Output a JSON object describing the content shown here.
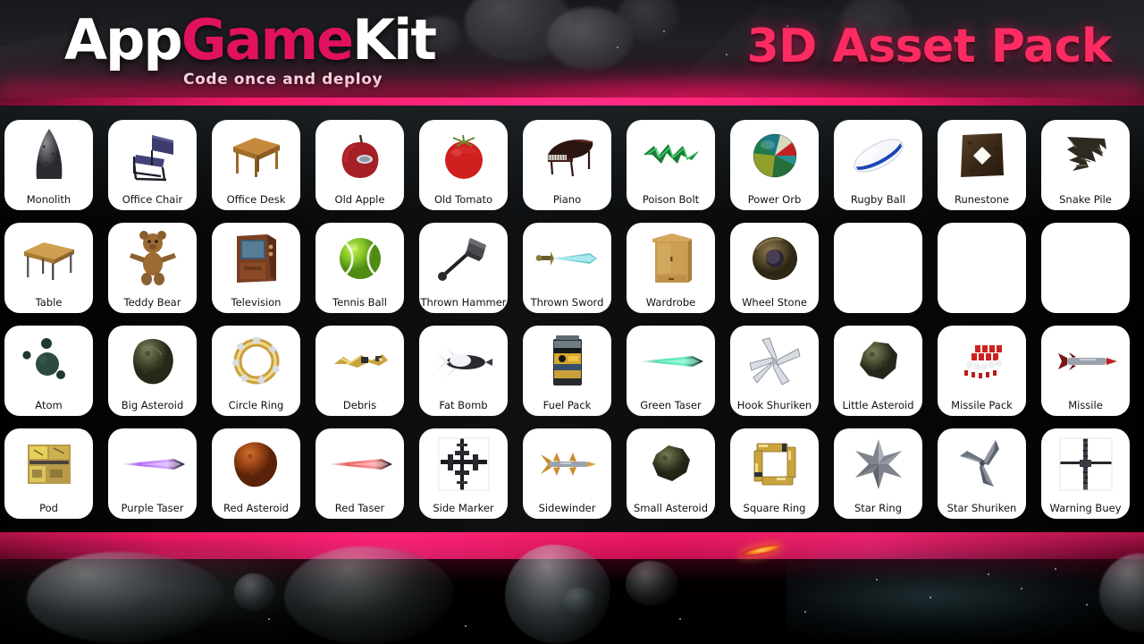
{
  "header": {
    "logo_part1": "App",
    "logo_part2": "Game",
    "logo_part3": "Kit",
    "tagline": "Code once and deploy",
    "pack_title": "3D Asset Pack",
    "colors": {
      "logo_white": "#ffffff",
      "logo_pink": "#e0115f",
      "title_pink": "#fc2c63",
      "glow_pink": "#ff2a80",
      "header_dark": "#18181b"
    }
  },
  "grid": {
    "rows": [
      [
        {
          "label": "Monolith",
          "icon": "monolith-icon"
        },
        {
          "label": "Office Chair",
          "icon": "office-chair-icon"
        },
        {
          "label": "Office Desk",
          "icon": "office-desk-icon"
        },
        {
          "label": "Old Apple",
          "icon": "old-apple-icon"
        },
        {
          "label": "Old Tomato",
          "icon": "old-tomato-icon"
        },
        {
          "label": "Piano",
          "icon": "piano-icon"
        },
        {
          "label": "Poison Bolt",
          "icon": "poison-bolt-icon"
        },
        {
          "label": "Power Orb",
          "icon": "power-orb-icon"
        },
        {
          "label": "Rugby Ball",
          "icon": "rugby-ball-icon"
        },
        {
          "label": "Runestone",
          "icon": "runestone-icon"
        },
        {
          "label": "Snake Pile",
          "icon": "snake-pile-icon"
        }
      ],
      [
        {
          "label": "Table",
          "icon": "table-icon"
        },
        {
          "label": "Teddy Bear",
          "icon": "teddy-bear-icon"
        },
        {
          "label": "Television",
          "icon": "television-icon"
        },
        {
          "label": "Tennis Ball",
          "icon": "tennis-ball-icon"
        },
        {
          "label": "Thrown Hammer",
          "icon": "thrown-hammer-icon"
        },
        {
          "label": "Thrown Sword",
          "icon": "thrown-sword-icon"
        },
        {
          "label": "Wardrobe",
          "icon": "wardrobe-icon"
        },
        {
          "label": "Wheel Stone",
          "icon": "wheel-stone-icon"
        },
        {
          "label": "",
          "icon": "empty-tile"
        },
        {
          "label": "",
          "icon": "empty-tile"
        },
        {
          "label": "",
          "icon": "empty-tile"
        }
      ],
      [
        {
          "label": "Atom",
          "icon": "atom-icon"
        },
        {
          "label": "Big Asteroid",
          "icon": "big-asteroid-icon"
        },
        {
          "label": "Circle Ring",
          "icon": "circle-ring-icon"
        },
        {
          "label": "Debris",
          "icon": "debris-icon"
        },
        {
          "label": "Fat Bomb",
          "icon": "fat-bomb-icon"
        },
        {
          "label": "Fuel Pack",
          "icon": "fuel-pack-icon"
        },
        {
          "label": "Green Taser",
          "icon": "green-taser-icon"
        },
        {
          "label": "Hook Shuriken",
          "icon": "hook-shuriken-icon"
        },
        {
          "label": "Little Asteroid",
          "icon": "little-asteroid-icon"
        },
        {
          "label": "Missile Pack",
          "icon": "missile-pack-icon"
        },
        {
          "label": "Missile",
          "icon": "missile-icon"
        }
      ],
      [
        {
          "label": "Pod",
          "icon": "pod-icon"
        },
        {
          "label": "Purple Taser",
          "icon": "purple-taser-icon"
        },
        {
          "label": "Red Asteroid",
          "icon": "red-asteroid-icon"
        },
        {
          "label": "Red Taser",
          "icon": "red-taser-icon"
        },
        {
          "label": "Side Marker",
          "icon": "side-marker-icon"
        },
        {
          "label": "Sidewinder",
          "icon": "sidewinder-icon"
        },
        {
          "label": "Small Asteroid",
          "icon": "small-asteroid-icon"
        },
        {
          "label": "Square Ring",
          "icon": "square-ring-icon"
        },
        {
          "label": "Star Ring",
          "icon": "star-ring-icon"
        },
        {
          "label": "Star Shuriken",
          "icon": "star-shuriken-icon"
        },
        {
          "label": "Warning Buey",
          "icon": "warning-buey-icon"
        }
      ]
    ]
  },
  "footer": {
    "scene": "space-asteroid-field"
  }
}
